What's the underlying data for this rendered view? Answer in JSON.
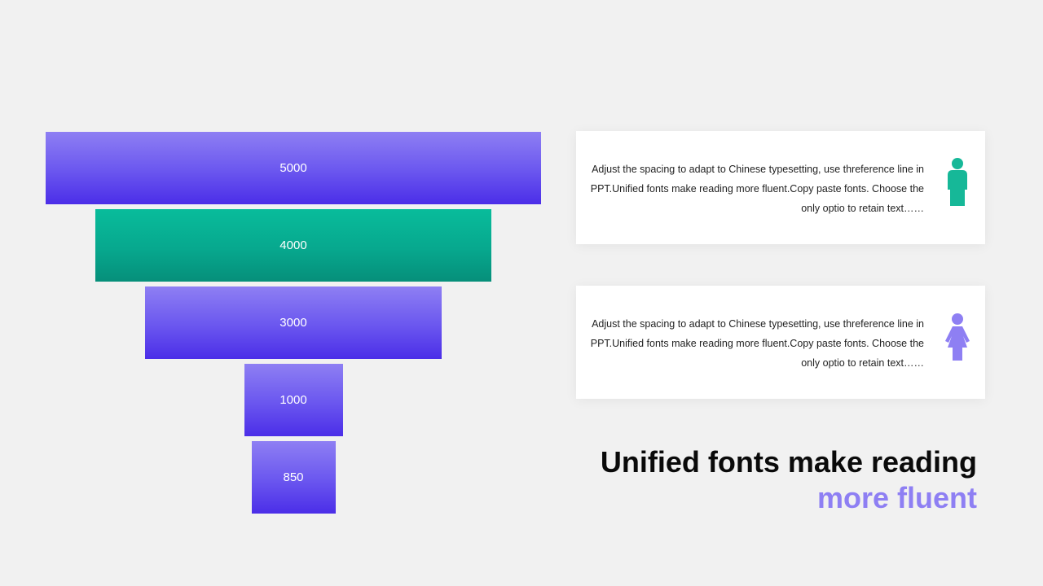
{
  "chart_data": {
    "type": "bar",
    "orientation": "funnel",
    "categories": [
      "",
      "",
      "",
      "",
      ""
    ],
    "values": [
      5000,
      4000,
      3000,
      1000,
      850
    ],
    "labels": [
      "5000",
      "4000",
      "3000",
      "1000",
      "850"
    ],
    "colors": [
      "#6a56ef",
      "#07a88e",
      "#6a56ef",
      "#6a56ef",
      "#6a56ef"
    ],
    "title": "",
    "xlabel": "",
    "ylabel": "",
    "legend": "none",
    "grid": false
  },
  "cards": [
    {
      "text": "Adjust the spacing to adapt to Chinese typesetting, use threference line in PPT.Unified fonts make reading more fluent.Copy paste fonts. Choose the only optio to retain text……",
      "icon": "male-person-icon",
      "icon_color": "#16b898"
    },
    {
      "text": "Adjust the spacing to adapt to Chinese typesetting, use threference line in PPT.Unified fonts make reading more fluent.Copy paste fonts. Choose the only optio to retain text……",
      "icon": "female-person-icon",
      "icon_color": "#8e7ff3"
    }
  ],
  "headline": {
    "line1": "Unified fonts make reading",
    "line2": "more fluent"
  },
  "colors": {
    "background": "#f1f1f1",
    "accent_purple": "#8e7ff3",
    "accent_teal": "#07a88e"
  }
}
